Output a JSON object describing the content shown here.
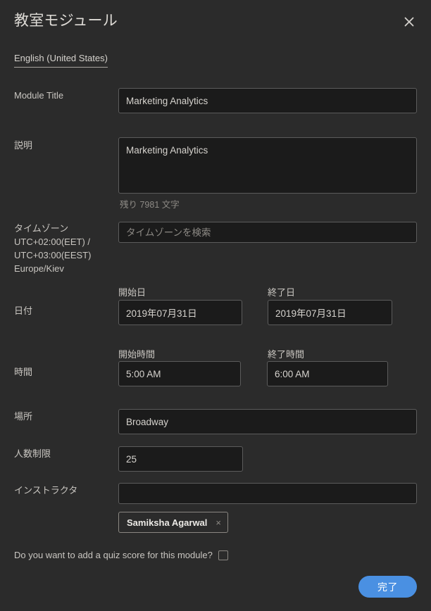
{
  "dialog": {
    "title": "教室モジュール",
    "close_label": "×",
    "close_icon": "close-icon"
  },
  "language_tabs": {
    "items": [
      {
        "label": "English (United States)",
        "selected": true
      }
    ]
  },
  "form": {
    "module_title": {
      "label": "Module Title",
      "value": "Marketing Analytics",
      "placeholder": ""
    },
    "description": {
      "label": "説明",
      "value": "Marketing Analytics",
      "placeholder": "",
      "counter": "残り 7981 文字"
    },
    "timezone": {
      "label": "タイムゾーン\nUTC+02:00(EET) /\nUTC+03:00(EEST)\nEurope/Kiev",
      "value": "",
      "placeholder": "タイムゾーンを検索"
    },
    "date": {
      "label": "日付",
      "start": {
        "sub_label": "開始日",
        "value": "2019年07月31日"
      },
      "end": {
        "sub_label": "終了日",
        "value": "2019年07月31日"
      }
    },
    "time": {
      "label": "時間",
      "start": {
        "sub_label": "開始時間",
        "value": "5:00 AM"
      },
      "end": {
        "sub_label": "終了時間",
        "value": "6:00 AM"
      }
    },
    "location": {
      "label": "場所",
      "value": "Broadway",
      "placeholder": ""
    },
    "capacity": {
      "label": "人数制限",
      "value": "25",
      "placeholder": ""
    },
    "instructor": {
      "label": "インストラクタ",
      "value": "",
      "placeholder": "",
      "chips": [
        {
          "label": "Samiksha Agarwal",
          "remove_label": "×"
        }
      ]
    },
    "quiz_score": {
      "label": "Do you want to add a quiz score for this module?",
      "checked": false
    }
  },
  "footer": {
    "submit_label": "完了"
  },
  "colors": {
    "background": "#2b2b2b",
    "input_background": "#1b1b1b",
    "input_border": "#5c5c5c",
    "text": "#d6d3ce",
    "muted_text": "#8d8a85",
    "accent": "#4a90e2"
  }
}
